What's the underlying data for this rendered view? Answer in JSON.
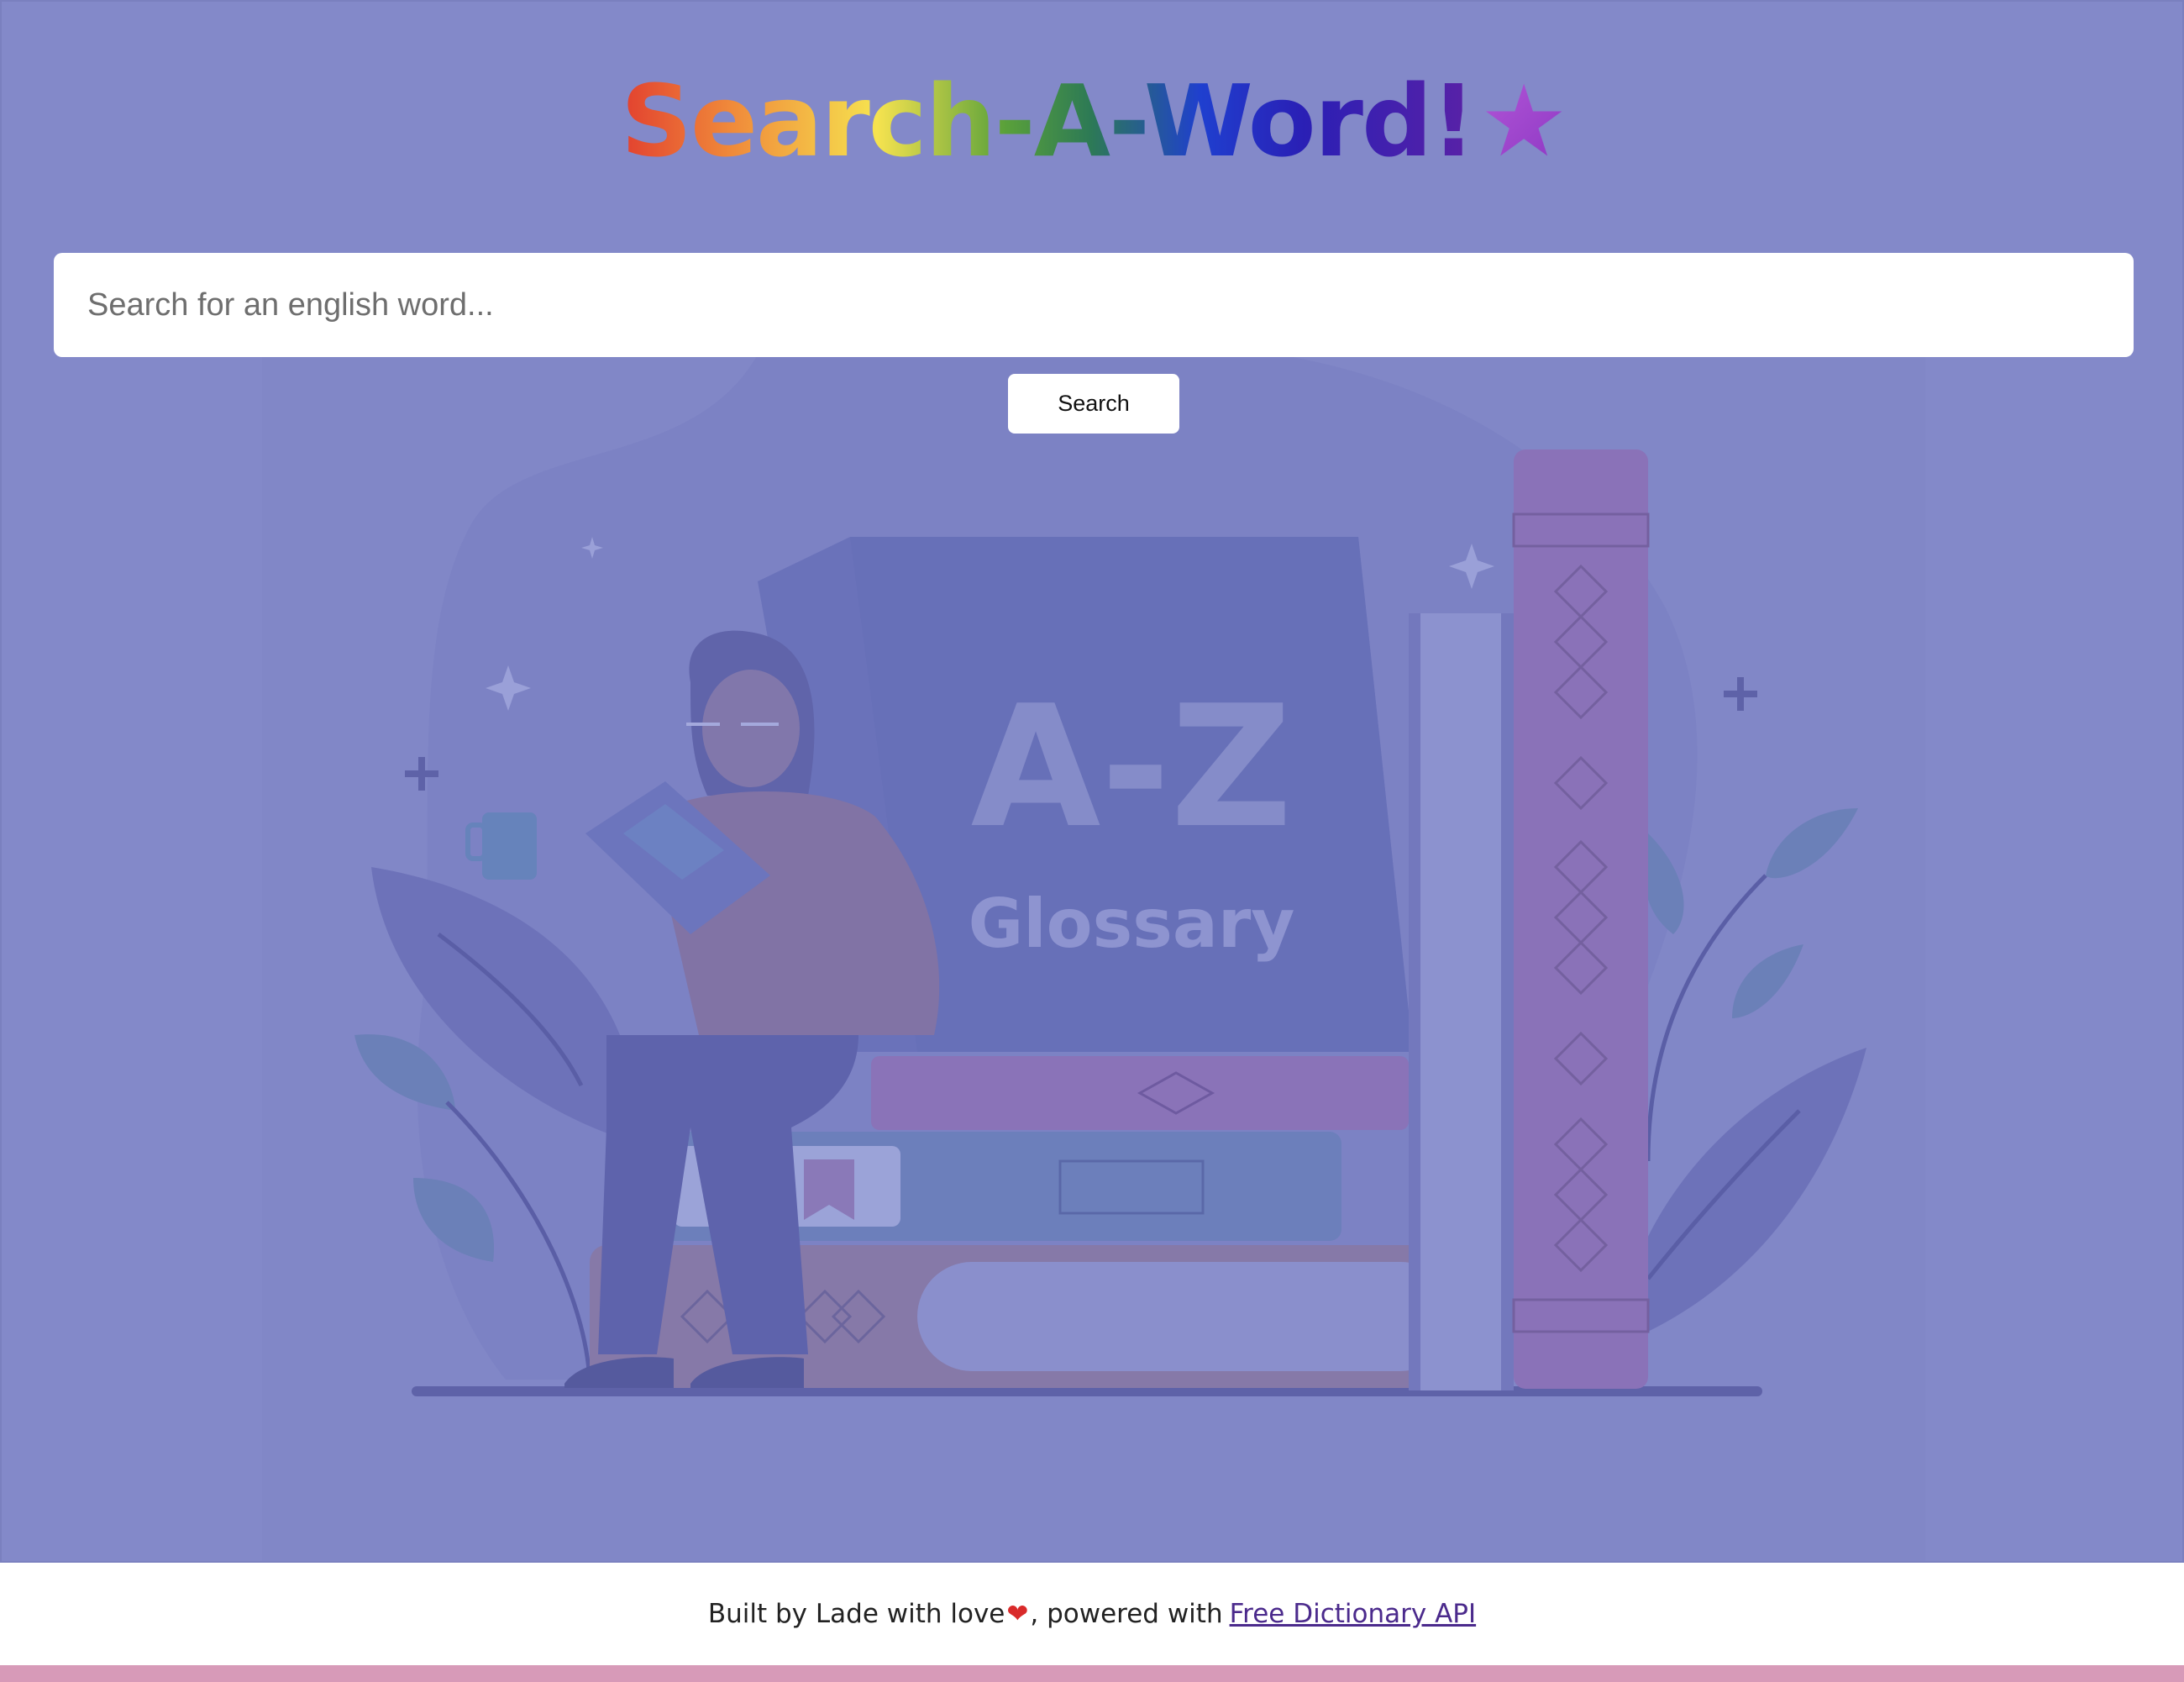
{
  "header": {
    "title": "Search-A-Word!",
    "title_star": "★"
  },
  "search": {
    "placeholder": "Search for an english word...",
    "value": "",
    "button_label": "Search"
  },
  "illustration": {
    "book_big_title": "A-Z",
    "book_big_subtitle": "Glossary"
  },
  "footer": {
    "text_before": "Built by Lade with love",
    "heart": "❤",
    "text_after": ", powered with",
    "link_text": "Free Dictionary API"
  },
  "colors": {
    "background": "#8389c9",
    "bottom_bar": "#d79ab8",
    "link": "#4b2a8c"
  }
}
